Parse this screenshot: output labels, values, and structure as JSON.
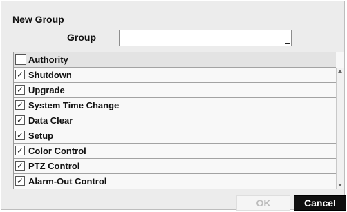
{
  "dialog": {
    "title": "New Group",
    "group_label": "Group",
    "group_value": ""
  },
  "authority": {
    "header_label": "Authority",
    "header_checked": false,
    "items": [
      {
        "label": "Shutdown",
        "checked": true
      },
      {
        "label": "Upgrade",
        "checked": true
      },
      {
        "label": "System Time Change",
        "checked": true
      },
      {
        "label": "Data Clear",
        "checked": true
      },
      {
        "label": "Setup",
        "checked": true
      },
      {
        "label": "Color Control",
        "checked": true
      },
      {
        "label": "PTZ Control",
        "checked": true
      },
      {
        "label": "Alarm-Out Control",
        "checked": true
      }
    ]
  },
  "buttons": {
    "ok_label": "OK",
    "cancel_label": "Cancel"
  },
  "glyphs": {
    "check": "✓"
  }
}
